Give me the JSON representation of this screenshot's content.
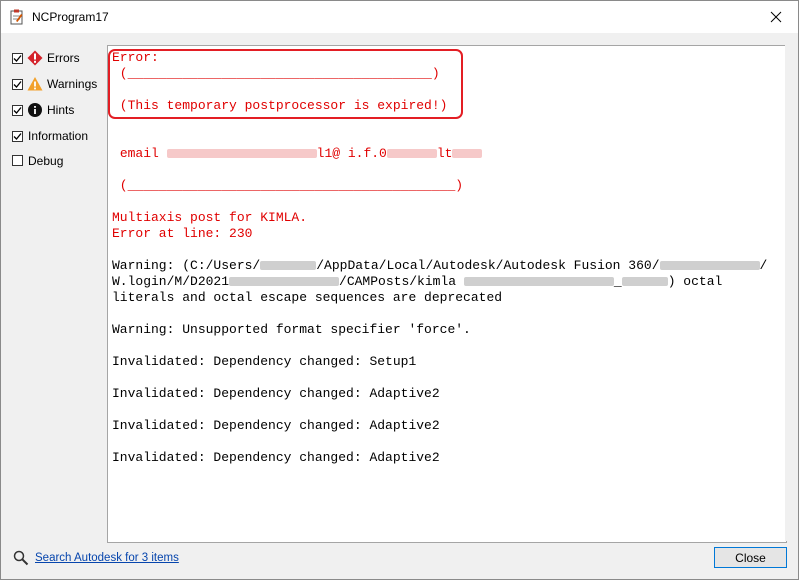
{
  "window": {
    "title": "NCProgram17",
    "close_glyph": "✕"
  },
  "filters": [
    {
      "label": "Errors",
      "checked": true,
      "icon": "error-icon"
    },
    {
      "label": "Warnings",
      "checked": true,
      "icon": "warning-icon"
    },
    {
      "label": "Hints",
      "checked": true,
      "icon": "hint-icon"
    },
    {
      "label": "Information",
      "checked": true,
      "icon": "none"
    },
    {
      "label": "Debug",
      "checked": false,
      "icon": "none"
    }
  ],
  "log": {
    "error_header": "Error:",
    "error_underline": " (_______________________________________)",
    "error_expired": " (This temporary postprocessor is expired!)",
    "email_prefix": "email",
    "email_tail": "l1@ i.f.0",
    "email_tail2": "lt",
    "underline2": " (__________________________________________)",
    "multiaxis": "Multiaxis post for KIMLA.",
    "error_line": "Error at line: 230",
    "warning_path_1a": "Warning: (C:/Users/",
    "warning_path_1b": "/AppData/Local/Autodesk/Autodesk Fusion 360/",
    "warning_path_1c": "/",
    "warning_path_2a": "W.login/M/D2021",
    "warning_path_2b": "/CAMPosts/kimla",
    "warning_path_2c": "_",
    "warning_path_2d": ") octal",
    "warning_path_3": "literals and octal escape sequences are deprecated",
    "warning_format": "Warning: Unsupported format specifier 'force'.",
    "invalidated": [
      "Invalidated: Dependency changed: Setup1",
      "Invalidated: Dependency changed: Adaptive2",
      "Invalidated: Dependency changed: Adaptive2",
      "Invalidated: Dependency changed: Adaptive2"
    ]
  },
  "footer": {
    "search_icon": "search-icon",
    "search_link": "Search Autodesk for 3 items",
    "close_label": "Close"
  },
  "colors": {
    "error_red": "#e00000",
    "highlight_red": "#e31e24",
    "link_blue": "#0645ad",
    "focus_blue": "#0078d7"
  }
}
